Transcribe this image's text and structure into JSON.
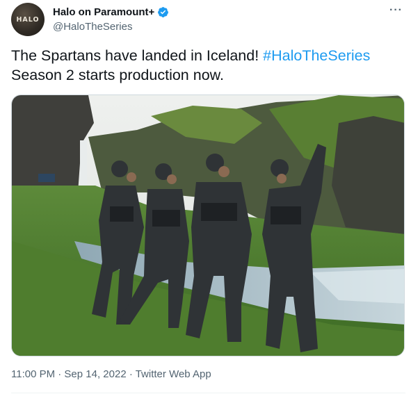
{
  "tweet": {
    "author": {
      "avatar_text": "HALO",
      "display_name": "Halo on Paramount+",
      "handle": "@HaloTheSeries",
      "verified": true
    },
    "more_label": "···",
    "text_part1": "The Spartans have landed in Iceland! ",
    "hashtag": "#HaloTheSeries",
    "text_part2": "Season 2 starts production now.",
    "photo": {
      "description_icon": "photo-image"
    },
    "timestamp": "11:00 PM · Sep 14, 2022 · Twitter Web App"
  },
  "colors": {
    "link": "#1d9bf0",
    "secondary_text": "#536471",
    "primary_text": "#0f1419",
    "verified": "#1d9bf0"
  }
}
